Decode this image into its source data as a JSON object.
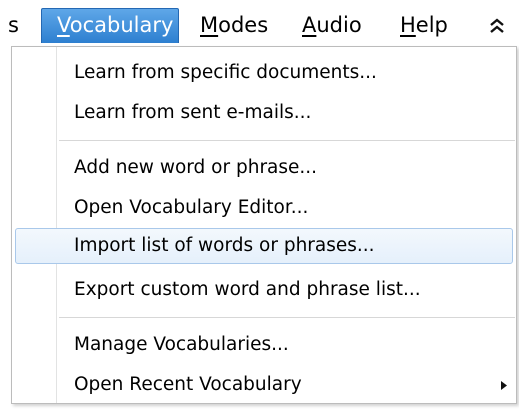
{
  "menubar": {
    "items": [
      {
        "label": "s"
      },
      {
        "label": "Vocabulary",
        "mnemonic": "V",
        "rest": "ocabulary",
        "active": true
      },
      {
        "label": "Modes",
        "mnemonic": "M",
        "rest": "odes"
      },
      {
        "label": "Audio",
        "mnemonic": "A",
        "rest": "udio"
      },
      {
        "label": "Help",
        "mnemonic": "H",
        "rest": "elp"
      }
    ],
    "collapse_icon": "double-chevron-up-icon"
  },
  "menu": {
    "groups": [
      {
        "items": [
          {
            "label": "Learn from specific documents..."
          },
          {
            "label": "Learn from sent e-mails..."
          }
        ]
      },
      {
        "items": [
          {
            "label": "Add new word or phrase..."
          },
          {
            "label": "Open Vocabulary Editor..."
          },
          {
            "label": "Import list of words or phrases...",
            "highlighted": true
          },
          {
            "label": "Export custom word and phrase list..."
          }
        ]
      },
      {
        "items": [
          {
            "label": "Manage Vocabularies..."
          },
          {
            "label": "Open Recent Vocabulary",
            "submenu": true,
            "submenu_icon": "triangle-right-icon"
          }
        ]
      }
    ]
  },
  "colors": {
    "active_menu_top": "#5fa7e8",
    "active_menu_bottom": "#2d7fd0",
    "hover_border": "#a9c8ea",
    "hover_fill": "#e5f0fb"
  }
}
